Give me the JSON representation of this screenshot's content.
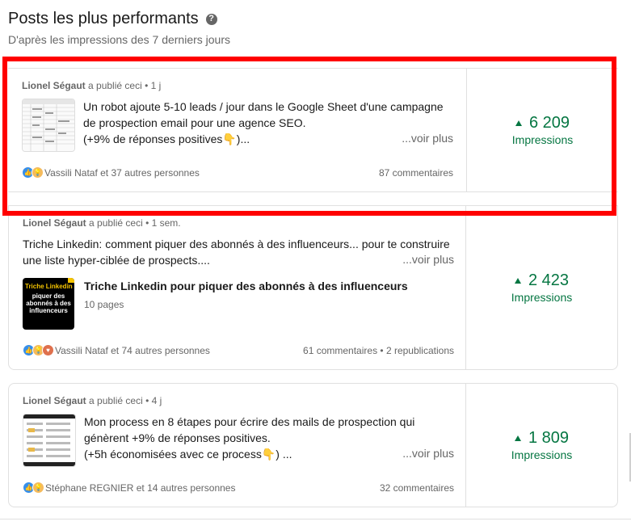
{
  "header": {
    "title": "Posts les plus performants",
    "subtitle": "D'après les impressions des 7 derniers jours"
  },
  "posts": [
    {
      "author": "Lionel Ségaut",
      "action": "a publié ceci",
      "time": "• 1 j",
      "text_line1": "Un robot ajoute 5-10 leads / jour dans le Google Sheet d'une campagne",
      "text_line2": "de prospection email pour une agence SEO.",
      "text_line3": "(+9% de réponses positives👇)...",
      "see_more": "...voir plus",
      "reactions": "Vassili Nataf et 37 autres personnes",
      "comments": "87 commentaires",
      "impressions": "6 209",
      "impressions_label": "Impressions"
    },
    {
      "author": "Lionel Ségaut",
      "action": "a publié ceci",
      "time": "• 1 sem.",
      "text_line1": "Triche Linkedin: comment piquer des abonnés à des influenceurs... pour te construire",
      "text_line2": "une liste hyper-ciblée de prospects....",
      "see_more": "...voir plus",
      "doc_title": "Triche Linkedin pour piquer des abonnés à des influenceurs",
      "doc_pages": "10 pages",
      "thumb_title": "Triche Linkedin :",
      "thumb_body": "piquer des abonnés à des influenceurs",
      "reactions": "Vassili Nataf et 74 autres personnes",
      "comments": "61 commentaires • 2 republications",
      "impressions": "2 423",
      "impressions_label": "Impressions"
    },
    {
      "author": "Lionel Ségaut",
      "action": "a publié ceci",
      "time": "• 4 j",
      "text_line1": "Mon process en 8 étapes pour écrire des mails de prospection qui",
      "text_line2": "génèrent +9% de réponses positives.",
      "text_line3": "(+5h économisées avec ce process👇) ...",
      "see_more": "...voir plus",
      "reactions": "Stéphane REGNIER et 14 autres personnes",
      "comments": "32 commentaires",
      "impressions": "1 809",
      "impressions_label": "Impressions"
    }
  ],
  "colors": {
    "impressions_green": "#057642",
    "highlight_red": "#ff0000",
    "like_blue": "#378fe9",
    "insight_yellow": "#f5bb5c",
    "love_orange": "#df704d"
  },
  "icons": {
    "help": "question-circle-icon",
    "trend": "triangle-up-icon",
    "reaction_like": "thumbs-up-icon",
    "reaction_insight": "lightbulb-icon",
    "reaction_love": "heart-icon"
  }
}
